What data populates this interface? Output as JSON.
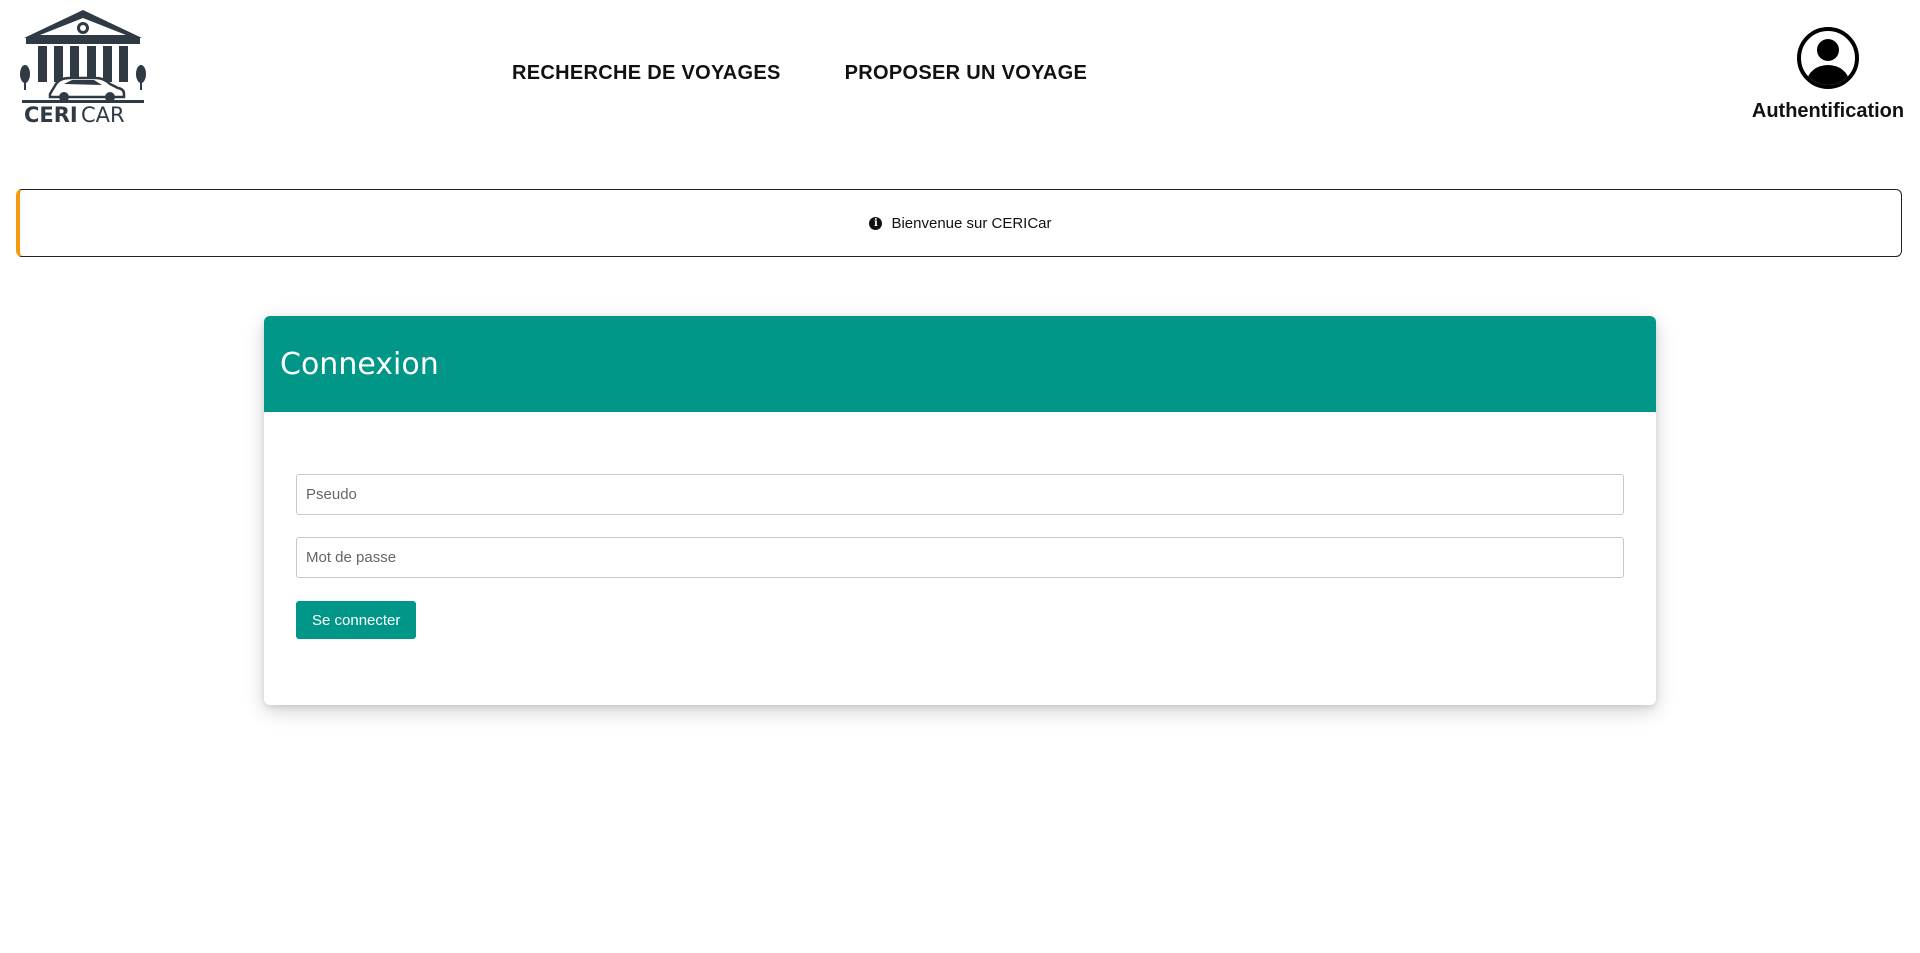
{
  "brand": {
    "name": "CERICar",
    "logo_text_dark": "CERI",
    "logo_text_light": "CAR",
    "logo_icon": "building-with-car-icon"
  },
  "nav": {
    "items": [
      {
        "label": "RECHERCHE DE VOYAGES"
      },
      {
        "label": "PROPOSER UN VOYAGE"
      }
    ]
  },
  "auth": {
    "icon": "user-circle-icon",
    "label": "Authentification"
  },
  "alert": {
    "icon": "info-circle-icon",
    "message": "Bienvenue sur CERICar",
    "accent_color": "#f39c12"
  },
  "login": {
    "title": "Connexion",
    "username_placeholder": "Pseudo",
    "username_value": "",
    "password_placeholder": "Mot de passe",
    "password_value": "",
    "submit_label": "Se connecter",
    "accent_color": "#009688"
  }
}
